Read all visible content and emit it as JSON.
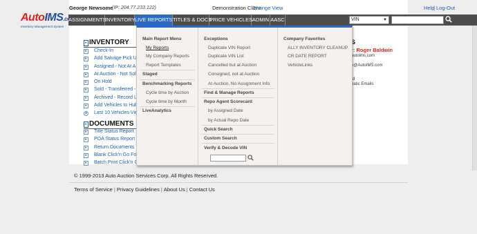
{
  "header": {
    "logo_text_a": "Auto",
    "logo_text_b": "IMS",
    "logo_text_c": ".com",
    "logo_sub": "Inventory Management System",
    "user_name": "George Newsome",
    "user_ip": "(IP: 204.77.233.122)",
    "client_name": "Demonstration Client",
    "change_view": "Change View",
    "help": "Help",
    "separator": "|",
    "logout": "Log-Out"
  },
  "nav": {
    "items": [
      {
        "label": "ASSIGNMENTS"
      },
      {
        "label": "INVENTORY"
      },
      {
        "label": "LIVE REPORTS"
      },
      {
        "label": "TITLES & DOCS"
      },
      {
        "label": "PRICE VEHICLES"
      },
      {
        "label": "ADMIN"
      },
      {
        "label": "AASC"
      }
    ],
    "search_type": "VIN",
    "search_value": ""
  },
  "inventory": {
    "title": "INVENTORY",
    "links": [
      "Check-In",
      "Add Salvage Pick Up",
      "Assigned - Not At A",
      "At Auction - Not Sol",
      "On Hold",
      "Sold - Transferred -",
      "Archived - Record L",
      "Add Vehicles to Hub",
      "Last 10 Vehicles Vie"
    ]
  },
  "documents": {
    "title": "DOCUMENTS",
    "links": [
      "Title Status Report",
      "POA Status Report",
      "Return Documents",
      "Blank Click'n Go Fo",
      "Batch Print Click'n G"
    ]
  },
  "contact": {
    "heading": "S",
    "name": "r: Roger Baldwin",
    "site": "autoims.com",
    "email": "e@AutoIMS.com",
    "line3": "rd",
    "line4": "natic Emails"
  },
  "dropdown": {
    "col1": {
      "main_head": "Main Report Menu",
      "my_reports": "My Reports",
      "my_company_reports": "My Company Reports",
      "report_templates": "Report Templates",
      "staged": "Staged",
      "benchmarking": "Benchmarking Reports",
      "cycle_auction": "Cycle time by Auction",
      "cycle_month": "Cycle time by Month",
      "live_analytics": "LiveAnalytics"
    },
    "col2": {
      "exceptions": "Exceptions",
      "dup_vin_report": "Duplicate VIN Report",
      "dup_vin_list": "Duplicate VIN List",
      "cancelled": "Cancelled but at Auction",
      "consigned": "Consigned, not at Auction",
      "no_assign": "At Auction, No Assignment Info",
      "find_manage": "Find & Manage Reports",
      "repo_agent": "Repo Agent Scorecard",
      "by_assigned": "by Assigned Date",
      "by_repo": "by Actual Repo Date",
      "quick_search": "Quick Search",
      "custom_search": "Custom Search",
      "verify_decode": "Verify & Decode VIN"
    },
    "col3": {
      "company_fav": "Company Favorites",
      "ally": "ALLY INVENTORY CLEANUP",
      "cr_date": "CR DATE REPORT",
      "vehiclelinks": "VehicleLinks"
    }
  },
  "footer": {
    "copyright": "© 1999-2013 Auto Auction Services Corp. All Rights Reserved.",
    "links": [
      "Terms of Service",
      "Privacy Guidelines",
      "About Us",
      "Contact Us"
    ]
  },
  "colors": {
    "accent": "#2a6ac4",
    "nav_bg": "#4d4d4d",
    "link": "#1d5fb3",
    "brand_red": "#d9251d"
  }
}
